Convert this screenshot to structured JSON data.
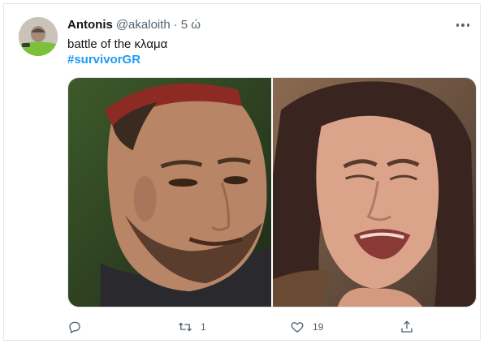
{
  "tweet": {
    "author": {
      "display_name": "Antonis",
      "handle": "@akaloith",
      "separator": "·",
      "timestamp": "5 ώ"
    },
    "text": "battle of the κλαμα",
    "hashtag": "#survivorGR",
    "media": [
      {
        "icon": "photo-crying-man"
      },
      {
        "icon": "photo-crying-woman"
      }
    ],
    "actions": {
      "reply_count": "",
      "retweet_count": "1",
      "like_count": "19"
    },
    "colors": {
      "link": "#1d9bf0",
      "muted": "#536471",
      "text": "#0f1419",
      "border": "#e1e8ed"
    }
  }
}
